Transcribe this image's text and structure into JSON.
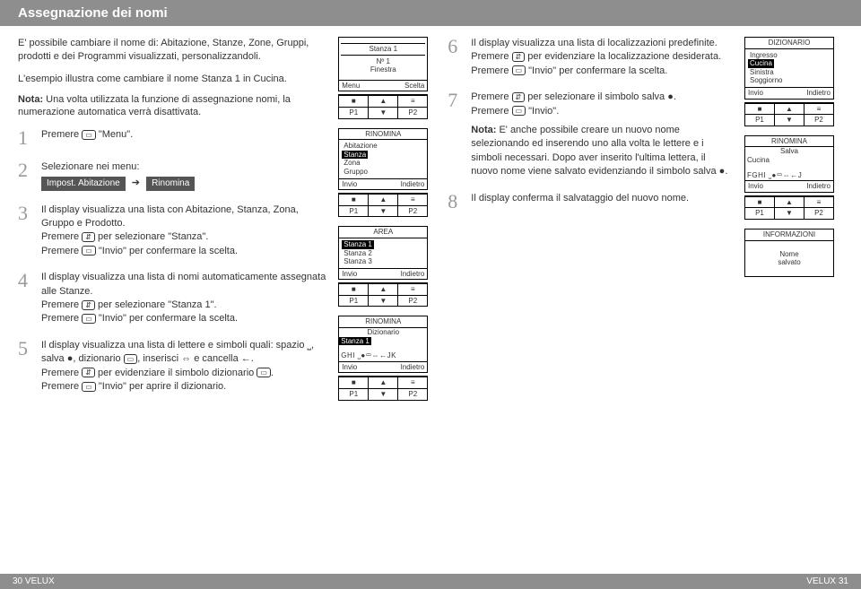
{
  "header": "Assegnazione dei nomi",
  "intro": "E' possibile cambiare il nome di: Abitazione, Stanze, Zone, Gruppi, prodotti e dei Programmi visualizzati, personalizzandoli.",
  "example": "L'esempio illustra come cambiare il nome Stanza 1 in Cucina.",
  "note_b": "Nota:",
  "note": " Una volta utilizzata la funzione di assegnazione nomi, la numerazione automatica verrà disattivata.",
  "steps": {
    "s1": {
      "n": "1",
      "t": "Premere ",
      "q": " \"Menu\"."
    },
    "s2": {
      "n": "2",
      "t": "Selezionare nei menu:",
      "pill1": "Impost. Abitazione",
      "arrow": "➔",
      "pill2": "Rinomina"
    },
    "s3": {
      "n": "3",
      "a": "Il display visualizza una lista con Abitazione, Stanza, Zona, Gruppo e Prodotto.",
      "b1": "Premere ",
      "b2": " per selezionare \"Stanza\".",
      "c1": "Premere ",
      "c2": " \"Invio\" per confermare la scelta."
    },
    "s4": {
      "n": "4",
      "a": "Il display visualizza una lista di nomi automaticamente assegnata alle Stanze.",
      "b1": "Premere ",
      "b2": " per selezionare \"Stanza 1\".",
      "c1": "Premere ",
      "c2": " \"Invio\" per confermare la scelta."
    },
    "s5": {
      "n": "5",
      "a1": "Il display visualizza una lista di lettere e simboli quali: spazio ",
      "sp": "⎵",
      "a2": ", salva ",
      "save": "●",
      "a3": ", dizionario ",
      "dict": "▭",
      "a4": ", inserisci ",
      "ins": "⇔",
      "a5": " e cancella ",
      "del": "←",
      "a6": ".",
      "b1": "Premere ",
      "b2": " per evidenziare il simbolo dizionario ",
      "b3": ".",
      "c1": "Premere ",
      "c2": " \"Invio\" per aprire il dizionario."
    },
    "s6": {
      "n": "6",
      "a": "Il display visualizza una lista di localizzazioni predefinite.",
      "b1": "Premere ",
      "b2": " per evidenziare la localizzazione desiderata.",
      "c1": "Premere ",
      "c2": " \"Invio\" per confermare la scelta."
    },
    "s7": {
      "n": "7",
      "a1": "Premere ",
      "a2": " per selezionare il simbolo salva ",
      "a3": ".",
      "b1": "Premere ",
      "b2": " \"Invio\".",
      "note_b": "Nota:",
      "note": " E' anche possibile creare un nuovo nome selezionando ed inserendo uno alla volta le lettere e i simboli necessari. Dopo aver inserito l'ultima lettera, il nuovo nome viene salvato evidenziando il simbolo salva ",
      "note2": "."
    },
    "s8": {
      "n": "8",
      "a": "Il display conferma il salvataggio del nuovo nome."
    }
  },
  "lcd": {
    "first": {
      "line1": "Stanza 1",
      "line2": "Nº 1",
      "line3": "Finestra",
      "menu": "Menu",
      "scelta": "Scelta"
    },
    "soft": {
      "p1": "P1",
      "p2": "P2",
      "stop": "■",
      "up": "▲",
      "down": "▼",
      "pause": "≡"
    },
    "rinomina": {
      "title": "RINOMINA",
      "i1": "Abitazione",
      "i2": "Stanza",
      "i3": "Zona",
      "i4": "Gruppo",
      "invio": "Invio",
      "indietro": "Indietro"
    },
    "area": {
      "title": "AREA",
      "i1": "Stanza 1",
      "i2": "Stanza 2",
      "i3": "Stanza 3",
      "invio": "Invio",
      "indietro": "Indietro"
    },
    "rin_diz": {
      "title": "RINOMINA",
      "sub": "Dizionario",
      "i1": "Stanza 1",
      "row": "GHI ⎵●▭⇔←JK",
      "invio": "Invio",
      "indietro": "Indietro"
    },
    "diz": {
      "title": "DIZIONARIO",
      "i1": "Ingresso",
      "i2": "Cucina",
      "i3": "Sinistra",
      "i4": "Soggiorno",
      "invio": "Invio",
      "indietro": "Indietro"
    },
    "rin_salva": {
      "title": "RINOMINA",
      "sub": "Salva",
      "i1": "Cucina",
      "row": "FGHI ⎵●▭⇔←J",
      "invio": "Invio",
      "indietro": "Indietro"
    },
    "info": {
      "title": "INFORMAZIONI",
      "l1": "Nome",
      "l2": "salvato"
    }
  },
  "footer": {
    "left": "30  VELUX",
    "right": "VELUX  31"
  },
  "btn": {
    "enter": "▭",
    "updown": "⇵"
  }
}
